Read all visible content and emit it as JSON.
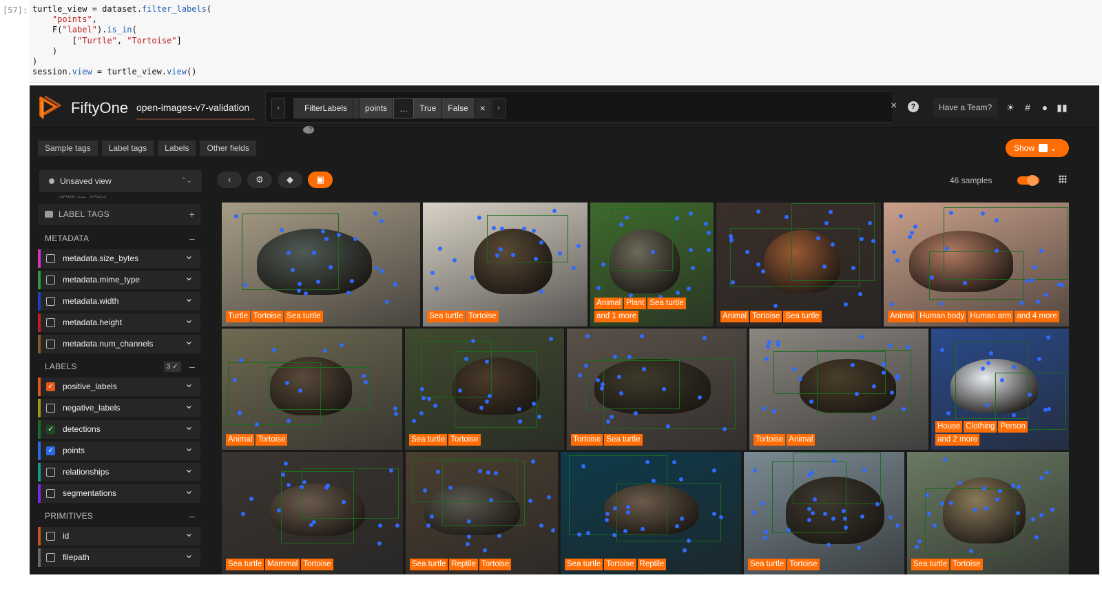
{
  "cell": {
    "prompt": "[57]:",
    "code": {
      "l1a": "turtle_view = dataset.",
      "l1b": "filter_labels",
      "l1c": "(",
      "l2": "\"points\"",
      "l2b": ",",
      "l3a": "F(",
      "l3b": "\"label\"",
      "l3c": ").",
      "l3d": "is_in",
      "l3e": "(",
      "l4a": "[",
      "l4b": "\"Turtle\"",
      "l4c": ", ",
      "l4d": "\"Tortoise\"",
      "l4e": "]",
      "l5": ")",
      "l6": ")",
      "l7a": "session.",
      "l7b": "view",
      "l7c": " = turtle_view.",
      "l7d": "view",
      "l7e": "()"
    }
  },
  "app": {
    "brand": "FiftyOne",
    "dataset": "open-images-v7-validation",
    "view_bar": {
      "prev": "›",
      "next": "›",
      "stage_name": "FilterLabels",
      "help": "?",
      "params": [
        "points",
        "…",
        "True",
        "False"
      ],
      "remove": "×",
      "clear": "×",
      "help_btn": "?"
    },
    "team_button": "Have a Team?",
    "top_icons": [
      "sun-icon",
      "slack-icon",
      "github-icon",
      "docs-icon"
    ],
    "tabs": [
      "Sample tags",
      "Label tags",
      "Labels",
      "Other fields"
    ],
    "show_button": "Show",
    "show_chevron": "⌄",
    "sidebar": {
      "view_select": "Unsaved view",
      "updown": "⌃⌄",
      "clipped": "SAMPLE TAGS",
      "label_tags": "LABEL TAGS",
      "plus": "+",
      "minus": "–",
      "metadata": "METADATA",
      "metadata_fields": [
        {
          "name": "metadata.size_bytes",
          "color": "#d633c4"
        },
        {
          "name": "metadata.mime_type",
          "color": "#2e9a3a"
        },
        {
          "name": "metadata.width",
          "color": "#1d3fc4"
        },
        {
          "name": "metadata.height",
          "color": "#c41d1d"
        },
        {
          "name": "metadata.num_channels",
          "color": "#8a5a2b"
        }
      ],
      "labels": "LABELS",
      "labels_count": "3 ✓",
      "label_fields": [
        {
          "name": "positive_labels",
          "color": "#e8571a",
          "checked": true,
          "check_color": "#e8571a"
        },
        {
          "name": "negative_labels",
          "color": "#9a9a1d",
          "checked": false
        },
        {
          "name": "detections",
          "color": "#1d6b2b",
          "checked": true,
          "check_color": "#1d4a23"
        },
        {
          "name": "points",
          "color": "#2a6be8",
          "checked": true,
          "check_color": "#2a6be8"
        },
        {
          "name": "relationships",
          "color": "#1d9a8a",
          "checked": false
        },
        {
          "name": "segmentations",
          "color": "#7a2ae8",
          "checked": false
        }
      ],
      "primitives": "PRIMITIVES",
      "primitive_fields": [
        {
          "name": "id",
          "color": "#c4571d"
        },
        {
          "name": "filepath",
          "color": "#6a6a6a"
        }
      ]
    },
    "grid": {
      "samples_count": "46 samples",
      "toolbar": [
        "chevron-left-icon",
        "gear-icon",
        "tag-icon",
        "patches-icon"
      ],
      "tiles": [
        {
          "tags": [
            "Turtle",
            "Tortoise",
            "Sea turtle"
          ]
        },
        {
          "tags": [
            "Sea turtle",
            "Tortoise"
          ]
        },
        {
          "tags": [
            "Animal",
            "Plant",
            "Sea turtle",
            "and 1 more"
          ]
        },
        {
          "tags": [
            "Animal",
            "Tortoise",
            "Sea turtle"
          ]
        },
        {
          "tags": [
            "Animal",
            "Human body",
            "Human arm",
            "and 4 more"
          ]
        },
        {
          "tags": [
            "Animal",
            "Tortoise"
          ]
        },
        {
          "tags": [
            "Sea turtle",
            "Tortoise"
          ]
        },
        {
          "tags": [
            "Tortoise",
            "Sea turtle"
          ]
        },
        {
          "tags": [
            "Tortoise",
            "Animal"
          ]
        },
        {
          "tags": [
            "House",
            "Clothing",
            "Person",
            "and 2 more"
          ]
        },
        {
          "tags": [
            "Sea turtle",
            "Mammal",
            "Tortoise"
          ]
        },
        {
          "tags": [
            "Sea turtle",
            "Reptile",
            "Tortoise"
          ]
        },
        {
          "tags": [
            "Sea turtle",
            "Tortoise",
            "Reptile"
          ]
        },
        {
          "tags": [
            "Sea turtle",
            "Tortoise"
          ]
        },
        {
          "tags": [
            "Sea turtle",
            "Tortoise"
          ]
        }
      ]
    },
    "colors": {
      "accent": "#ff6d04",
      "point": "#2f6bff",
      "bbox": "#1d6b1d"
    }
  }
}
